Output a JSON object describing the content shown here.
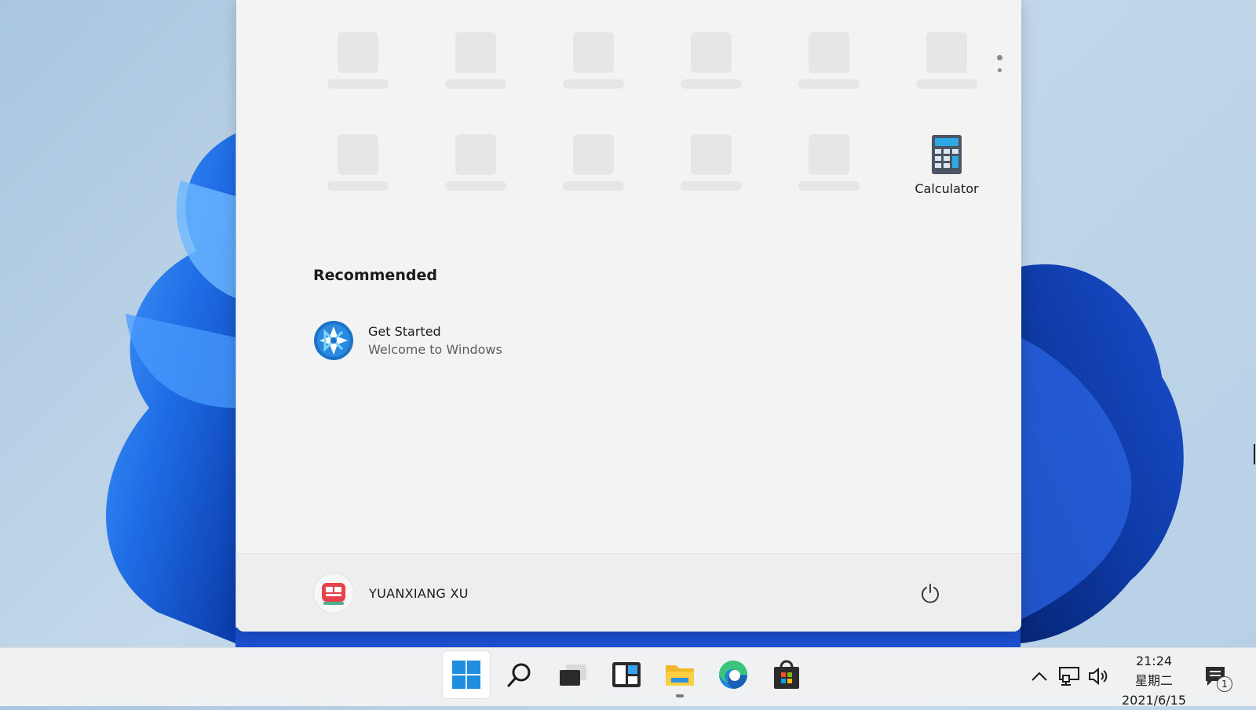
{
  "start_menu": {
    "pinned_placeholder_count": 11,
    "calculator_label": "Calculator",
    "recommended_header": "Recommended",
    "recommended_item": {
      "title": "Get Started",
      "subtitle": "Welcome to Windows",
      "icon": "get-started-icon"
    },
    "user_name": "YUANXIANG XU"
  },
  "taskbar": {
    "icons": [
      "windows-start-icon",
      "search-icon",
      "task-view-icon",
      "widgets-icon",
      "file-explorer-icon",
      "edge-icon",
      "store-icon"
    ],
    "clock_time": "21:24",
    "clock_day": "星期二",
    "clock_date": "2021/6/15",
    "notification_count": "1"
  },
  "colors": {
    "windows_blue": "#0078d4",
    "menu_bg": "#f3f3f3",
    "taskbar_bg": "#f0f1f3"
  }
}
